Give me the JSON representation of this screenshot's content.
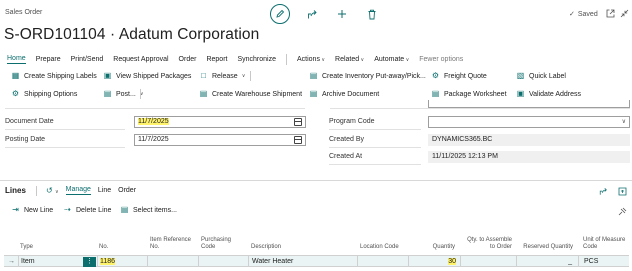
{
  "header": {
    "category": "Sales Order",
    "title": "S-ORD101104 · Adatum Corporation",
    "saved": "Saved",
    "icons": [
      "edit-icon",
      "share-icon",
      "add-icon",
      "delete-icon",
      "check-icon",
      "open-new-window-icon",
      "collapse-icon"
    ]
  },
  "tabs": [
    "Home",
    "Prepare",
    "Print/Send",
    "Request Approval",
    "Order",
    "Report",
    "Synchronize",
    "Actions",
    "Related",
    "Automate",
    "Fewer options"
  ],
  "actions": {
    "row1": [
      "Create Shipping Labels",
      "View Shipped Packages",
      "Release",
      "Create Inventory Put-away/Pick...",
      "Freight Quote",
      "Quick Label"
    ],
    "row2": [
      "Shipping Options",
      "Post...",
      "Create Warehouse Shipment",
      "Archive Document",
      "Package Worksheet",
      "Validate Address"
    ]
  },
  "fields": {
    "document_date_label": "Document Date",
    "document_date": "11/7/2025",
    "posting_date_label": "Posting Date",
    "posting_date": "11/7/2025",
    "program_code_label": "Program Code",
    "program_code": "",
    "created_by_label": "Created By",
    "created_by": "DYNAMICS365.BC",
    "created_at_label": "Created At",
    "created_at": "11/11/2025 12:13 PM"
  },
  "lines": {
    "title": "Lines",
    "tabs": [
      "Manage",
      "Line",
      "Order"
    ],
    "actions": [
      "New Line",
      "Delete Line",
      "Select items..."
    ],
    "columns": {
      "type": "Type",
      "no": "No.",
      "item_ref_no": "Item Reference No.",
      "purchasing_code": "Purchasing Code",
      "description": "Description",
      "location_code": "Location Code",
      "quantity": "Quantity",
      "qty_to_assemble": "Qty. to Assemble to Order",
      "reserved_quantity": "Reserved Quantity",
      "unit_of_measure": "Unit of Measure Code"
    },
    "row": {
      "type": "Item",
      "no": "1186",
      "description": "Water Heater",
      "quantity": "30",
      "reserved_quantity": "_",
      "unit_of_measure": "PCS"
    }
  },
  "colors": {
    "accent": "#0d6e6e",
    "highlight": "#fff36b"
  }
}
